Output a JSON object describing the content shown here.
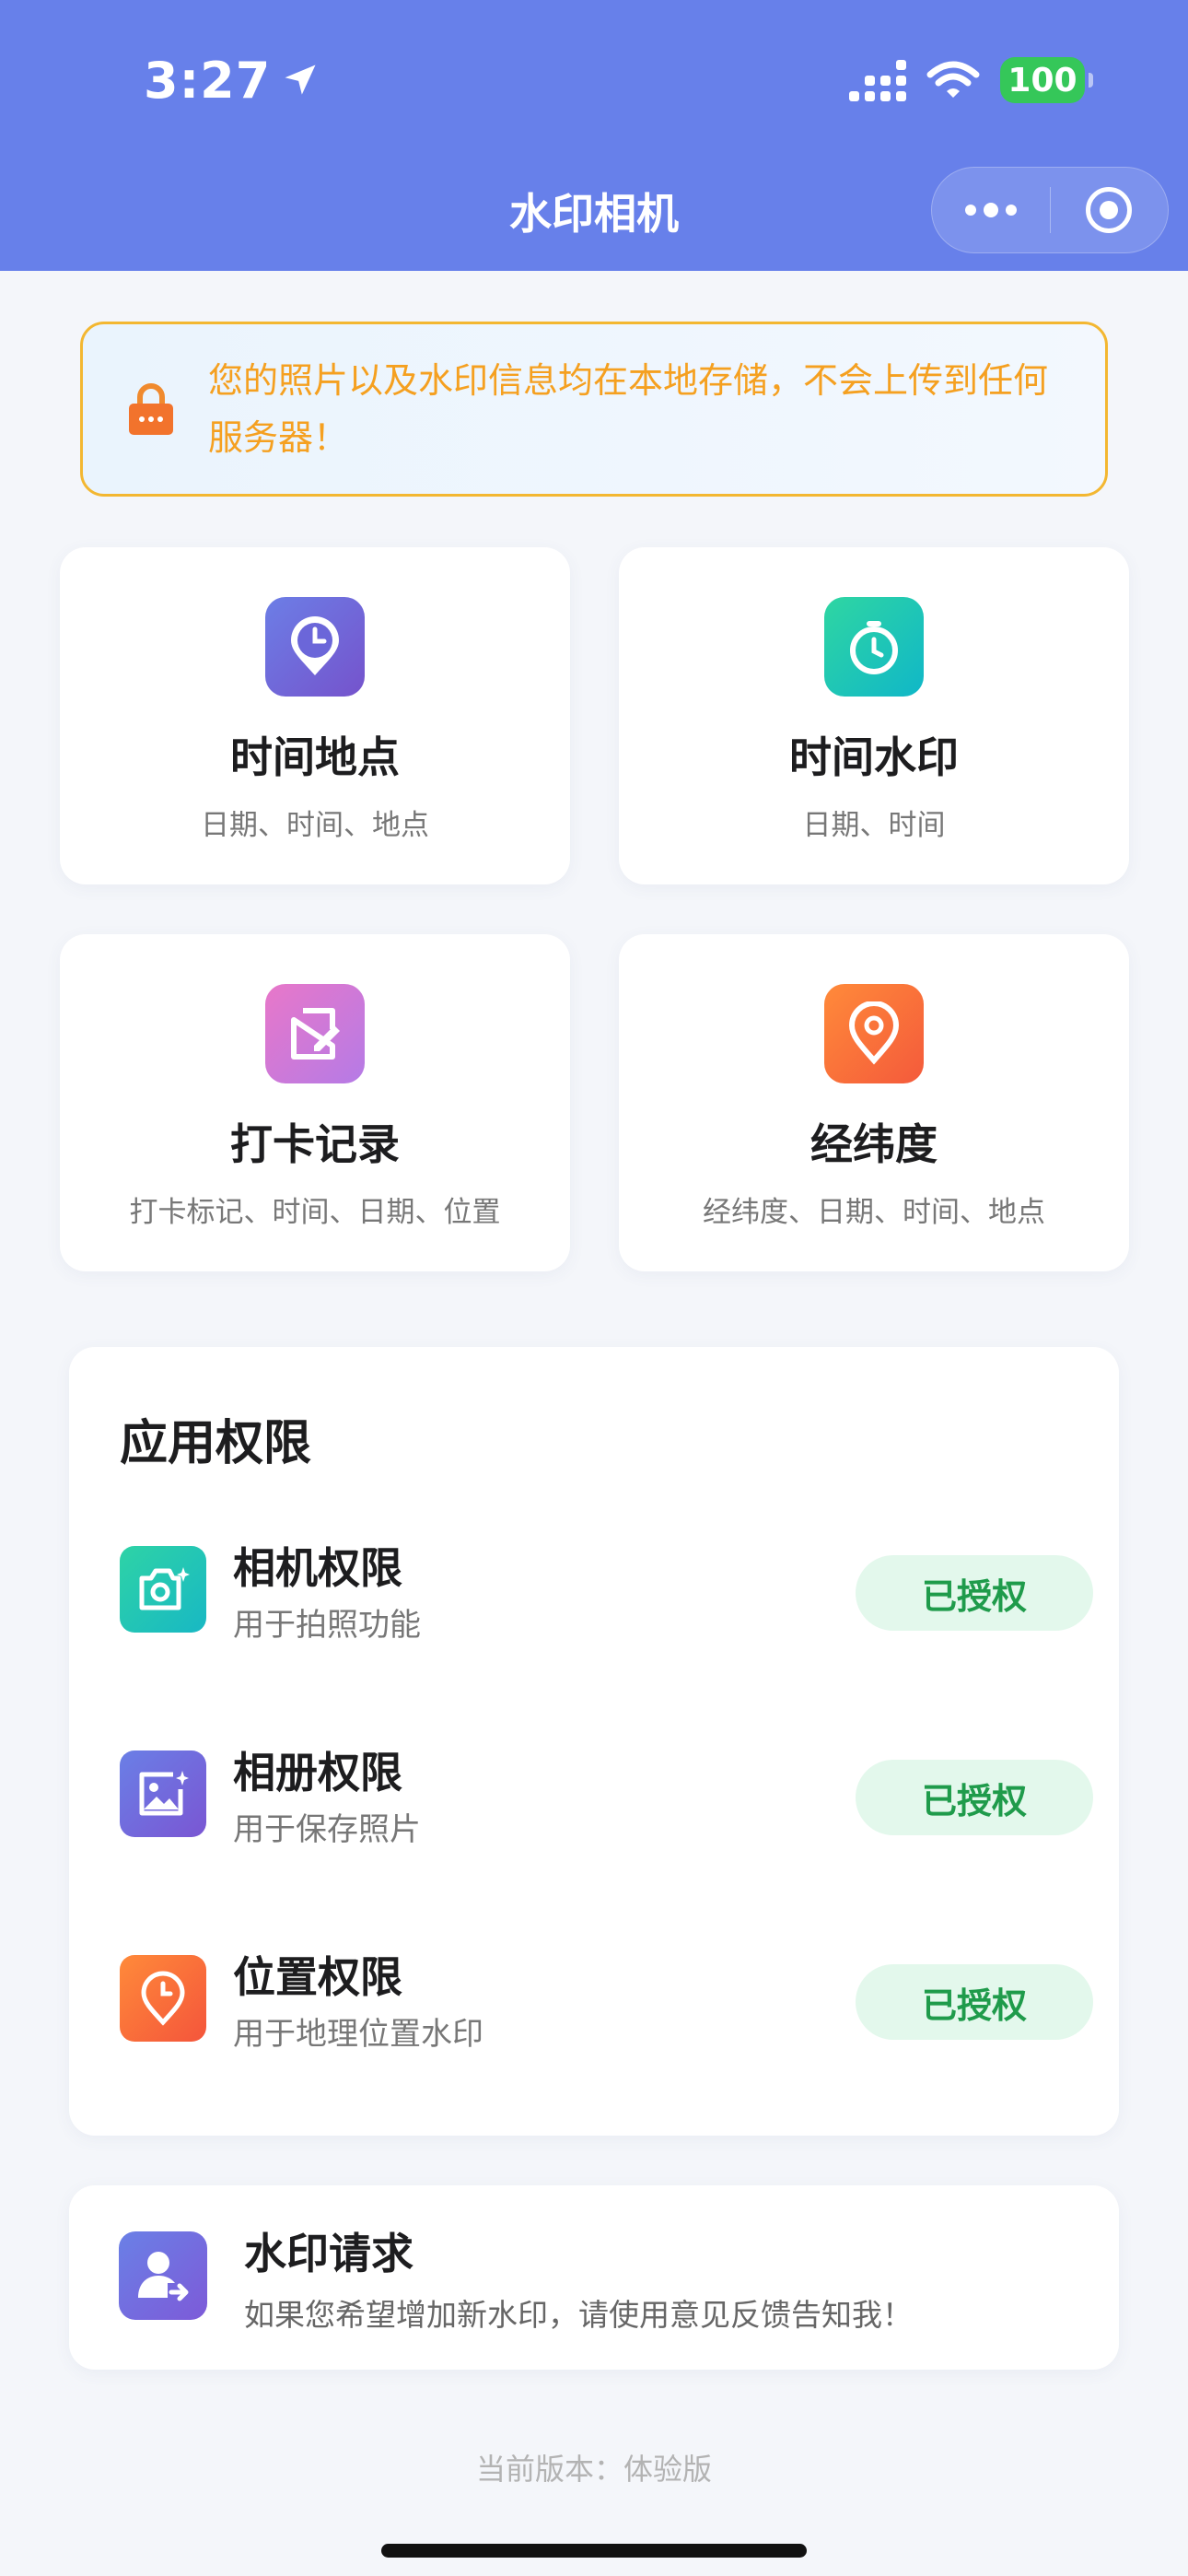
{
  "status_bar": {
    "time": "3:27",
    "battery": "100"
  },
  "nav": {
    "title": "水印相机"
  },
  "notice": {
    "text": "您的照片以及水印信息均在本地存储，不会上传到任何服务器！"
  },
  "features": [
    {
      "title": "时间地点",
      "desc": "日期、时间、地点",
      "icon": "clock-pin-icon",
      "color": "#5b66d6"
    },
    {
      "title": "时间水印",
      "desc": "日期、时间",
      "icon": "stopwatch-icon",
      "color": "#1fc4a0"
    },
    {
      "title": "打卡记录",
      "desc": "打卡标记、时间、日期、位置",
      "icon": "note-edit-icon",
      "color": "#d77bd8"
    },
    {
      "title": "经纬度",
      "desc": "经纬度、日期、时间、地点",
      "icon": "location-pin-icon",
      "color": "#f46a3a"
    }
  ],
  "permissions": {
    "heading": "应用权限",
    "items": [
      {
        "title": "相机权限",
        "desc": "用于拍照功能",
        "status": "已授权",
        "icon": "camera-icon"
      },
      {
        "title": "相册权限",
        "desc": "用于保存照片",
        "status": "已授权",
        "icon": "gallery-icon"
      },
      {
        "title": "位置权限",
        "desc": "用于地理位置水印",
        "status": "已授权",
        "icon": "clock-location-icon"
      }
    ]
  },
  "request": {
    "title": "水印请求",
    "desc": "如果您希望增加新水印，请使用意见反馈告知我！",
    "icon": "user-add-icon"
  },
  "version": {
    "text": "当前版本：体验版"
  }
}
